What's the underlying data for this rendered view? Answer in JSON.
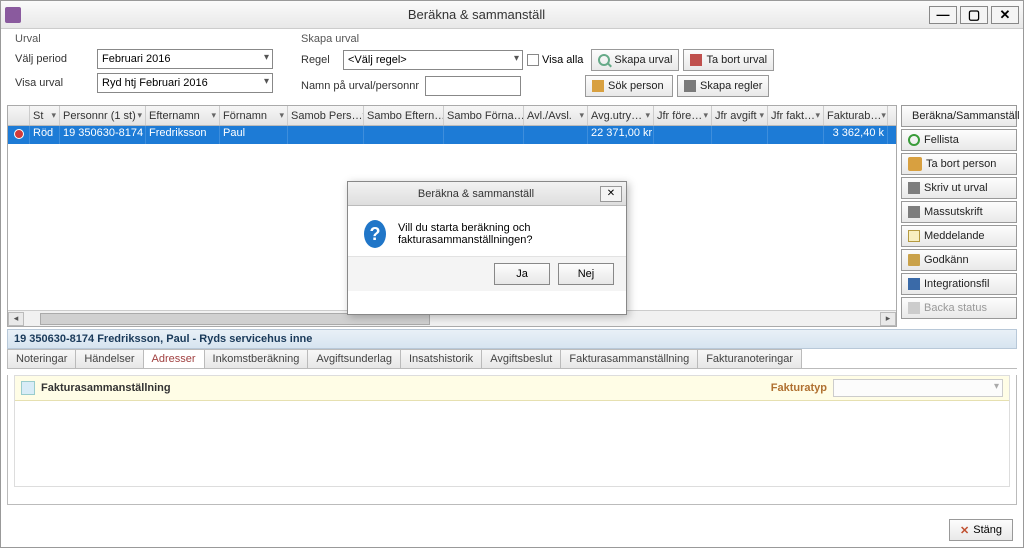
{
  "window": {
    "title": "Beräkna & sammanställ"
  },
  "urval": {
    "legend": "Urval",
    "period_label": "Välj period",
    "period_value": "Februari 2016",
    "visa_label": "Visa urval",
    "visa_value": "Ryd htj Februari 2016"
  },
  "skapa": {
    "legend": "Skapa urval",
    "regel_label": "Regel",
    "regel_value": "<Välj regel>",
    "namn_label": "Namn på urval/personnr",
    "namn_value": "",
    "visa_alla": "Visa alla",
    "btn_skapa_urval": "Skapa urval",
    "btn_ta_bort_urval": "Ta bort urval",
    "btn_sok_person": "Sök person",
    "btn_skapa_regler": "Skapa regler"
  },
  "grid": {
    "headers": [
      "",
      "St",
      "Personnr (1 st)",
      "Efternamn",
      "Förnamn",
      "Samob Pers…",
      "Sambo Eftern…",
      "Sambo Förna…",
      "Avl./Avsl.",
      "Avg.utry…",
      "Jfr före…",
      "Jfr avgift",
      "Jfr fakt…",
      "Fakturab…"
    ],
    "row": {
      "status": "Röd",
      "personnr": "19 350630-8174",
      "efternamn": "Fredriksson",
      "fornamn": "Paul",
      "avg_utry": "22 371,00 kr",
      "fakturab": "3 362,40 k"
    }
  },
  "side": {
    "berakna": "Beräkna/Sammanställ",
    "fellista": "Fellista",
    "ta_bort_person": "Ta bort person",
    "skriv_ut": "Skriv ut urval",
    "massutskrift": "Massutskrift",
    "meddelande": "Meddelande",
    "godkann": "Godkänn",
    "integrationsfil": "Integrationsfil",
    "backa_status": "Backa status"
  },
  "detail": {
    "header": "19 350630-8174 Fredriksson, Paul  -  Ryds servicehus inne",
    "tabs": [
      "Noteringar",
      "Händelser",
      "Adresser",
      "Inkomstberäkning",
      "Avgiftsunderlag",
      "Insatshistorik",
      "Avgiftsbeslut",
      "Fakturasammanställning",
      "Fakturanoteringar"
    ],
    "section_title": "Fakturasammanställning",
    "fakturatyp_label": "Fakturatyp"
  },
  "footer": {
    "close": "Stäng"
  },
  "modal": {
    "title": "Beräkna & sammanställ",
    "text": "Vill du starta beräkning och fakturasammanställningen?",
    "ja": "Ja",
    "nej": "Nej"
  }
}
